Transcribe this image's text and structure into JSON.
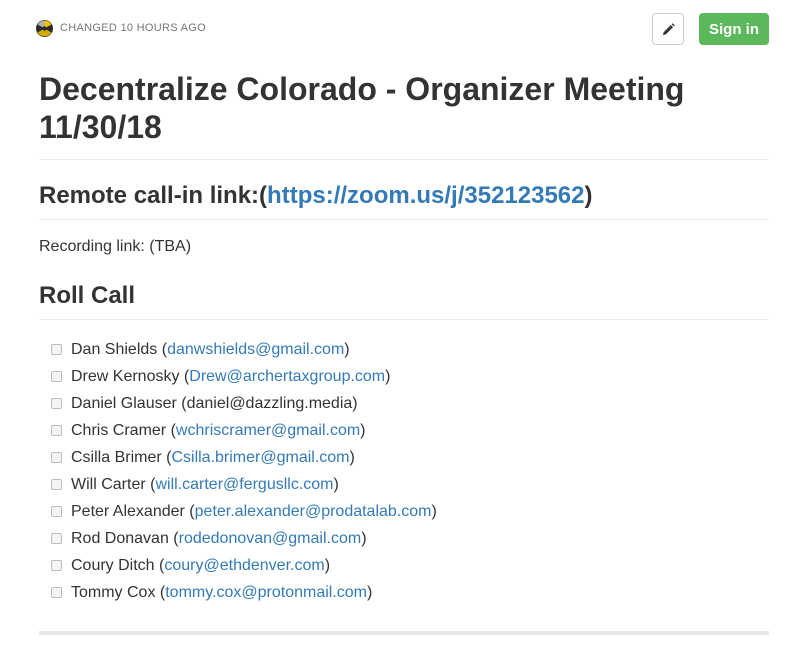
{
  "header": {
    "changed_label": "CHANGED 10 HOURS AGO",
    "signin_label": "Sign in",
    "edit_icon": "pencil-icon",
    "avatar_icon": "avatar"
  },
  "doc": {
    "title": "Decentralize Colorado - Organizer Meeting 11/30/18",
    "remote_prefix": "Remote call-in link:(",
    "remote_link": "https://zoom.us/j/352123562",
    "remote_suffix": ")",
    "recording": "Recording link: (TBA)",
    "roll_heading": "Roll Call"
  },
  "roll_call": [
    {
      "name": "Dan Shields",
      "email": "danwshields@gmail.com",
      "linked": true
    },
    {
      "name": "Drew Kernosky",
      "email": "Drew@archertaxgroup.com",
      "linked": true
    },
    {
      "name": "Daniel Glauser",
      "email": "daniel@dazzling.media",
      "linked": false
    },
    {
      "name": "Chris Cramer",
      "email": "wchriscramer@gmail.com",
      "linked": true
    },
    {
      "name": "Csilla Brimer",
      "email": "Csilla.brimer@gmail.com",
      "linked": true
    },
    {
      "name": "Will Carter",
      "email": "will.carter@fergusllc.com",
      "linked": true
    },
    {
      "name": "Peter Alexander",
      "email": "peter.alexander@prodatalab.com",
      "linked": true
    },
    {
      "name": "Rod Donavan",
      "email": "rodedonovan@gmail.com",
      "linked": true
    },
    {
      "name": "Coury Ditch",
      "email": "coury@ethdenver.com",
      "linked": true
    },
    {
      "name": "Tommy Cox",
      "email": "tommy.cox@protonmail.com",
      "linked": true
    }
  ],
  "colors": {
    "link": "#337ab7",
    "signin_bg": "#5cb85c",
    "text": "#333333"
  }
}
